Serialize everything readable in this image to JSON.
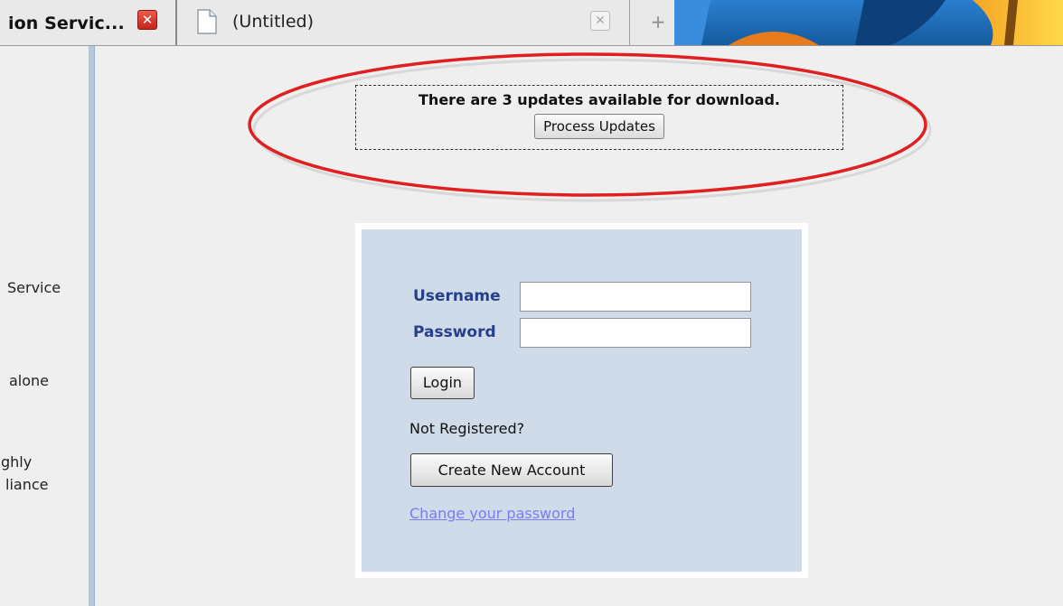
{
  "tabs": [
    {
      "title": "ion Servic...",
      "close_glyph": "✕",
      "active": true
    },
    {
      "title": "(Untitled)",
      "close_glyph": "✕",
      "active": false
    }
  ],
  "new_tab_glyph": "+",
  "sidebar_fragments": [
    "Service",
    "alone",
    "ghly",
    "liance"
  ],
  "update_notice": {
    "message": "There are 3 updates available for download.",
    "button_label": "Process Updates",
    "highlight_color": "#e02020"
  },
  "login": {
    "username_label": "Username",
    "username_value": "",
    "password_label": "Password",
    "password_value": "",
    "login_button": "Login",
    "not_registered_text": "Not Registered?",
    "create_account_button": "Create New Account",
    "change_password_link": "Change your password"
  },
  "colors": {
    "label_blue": "#263f8a",
    "panel_bg": "#cfdbe8",
    "link": "#7c7cf0"
  }
}
